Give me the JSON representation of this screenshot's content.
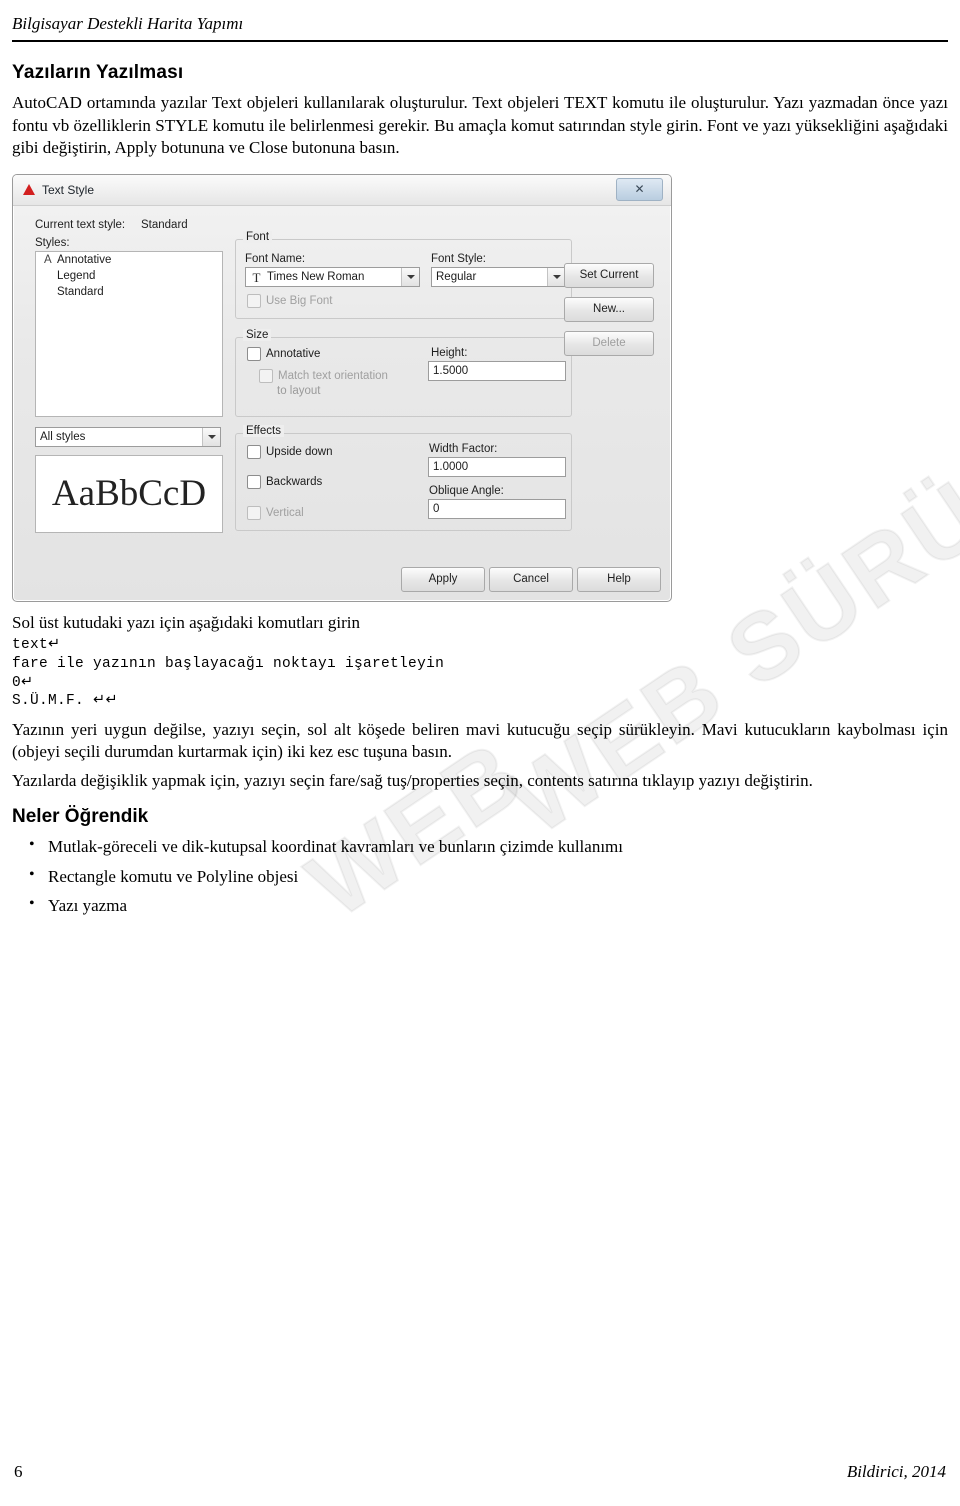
{
  "header": {
    "running_title": "Bilgisayar Destekli Harita Yapımı"
  },
  "section": {
    "title": "Yazıların Yazılması",
    "paragraph1": "AutoCAD ortamında yazılar Text objeleri kullanılarak oluşturulur. Text objeleri TEXT komutu ile oluşturulur. Yazı yazmadan önce yazı fontu vb özelliklerin STYLE komutu ile belirlenmesi gerekir. Bu amaçla komut satırından style girin. Font ve yazı yüksekliğini aşağıdaki gibi değiştirin, Apply botununa ve Close butonuna basın."
  },
  "dialog": {
    "title": "Text Style",
    "close_label": "✕",
    "current_style_label": "Current text style:",
    "current_style_value": "Standard",
    "styles_label": "Styles:",
    "styles_list": [
      "Annotative",
      "Legend",
      "Standard"
    ],
    "styles_filter": "All styles",
    "preview_text": "AaBbCcD",
    "font_group": "Font",
    "font_name_label": "Font Name:",
    "font_name_value": "Times New Roman",
    "font_style_label": "Font Style:",
    "font_style_value": "Regular",
    "use_big_font_label": "Use Big Font",
    "size_group": "Size",
    "annotative_label": "Annotative",
    "match_text_orientation_label": "Match text orientation",
    "to_layout_label": "to layout",
    "height_label": "Height:",
    "height_value": "1.5000",
    "effects_group": "Effects",
    "upside_down_label": "Upside down",
    "backwards_label": "Backwards",
    "vertical_label": "Vertical",
    "width_factor_label": "Width Factor:",
    "width_factor_value": "1.0000",
    "oblique_angle_label": "Oblique Angle:",
    "oblique_angle_value": "0",
    "set_current_label": "Set Current",
    "new_label": "New...",
    "delete_label": "Delete",
    "apply_label": "Apply",
    "cancel_label": "Cancel",
    "help_label": "Help"
  },
  "commands": {
    "intro": "Sol üst kutudaki yazı için aşağıdaki komutları girin",
    "lines": [
      "text↵",
      "fare ile yazının başlayacağı noktayı işaretleyin",
      "0↵",
      "S.Ü.M.F. ↵↵"
    ]
  },
  "after_commands": {
    "paragraph1": "Yazının yeri uygun değilse, yazıyı seçin, sol alt köşede beliren mavi kutucuğu seçip sürükleyin. Mavi kutucukların kaybolması için (objeyi seçili durumdan kurtarmak için) iki kez esc tuşuna basın.",
    "paragraph2": "Yazılarda değişiklik yapmak için, yazıyı seçin fare/sağ tuş/properties seçin, contents satırına tıklayıp yazıyı değiştirin."
  },
  "learned": {
    "title": "Neler Öğrendik",
    "items": [
      "Mutlak-göreceli ve dik-kutupsal koordinat kavramları ve bunların çizimde kullanımı",
      "Rectangle komutu ve Polyline objesi",
      "Yazı yazma"
    ]
  },
  "watermark": {
    "line1": "WEB SÜRÜMÜ",
    "line2": "WEB"
  },
  "footer": {
    "page_number": "6",
    "attribution": "Bildirici, 2014"
  }
}
